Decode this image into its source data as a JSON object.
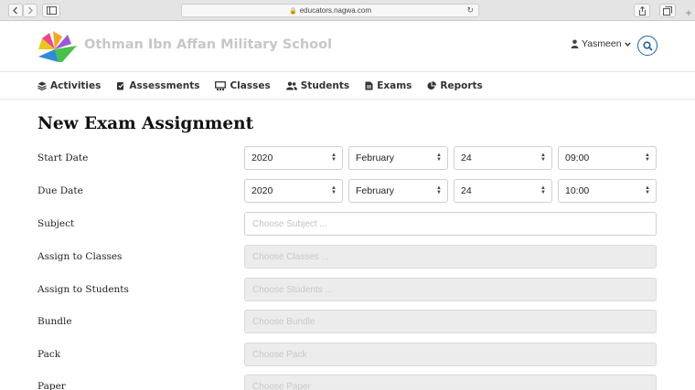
{
  "browser": {
    "url": "educators.nagwa.com"
  },
  "header": {
    "school_name": "Othman Ibn Affan Military School",
    "user_name": "Yasmeen"
  },
  "nav": {
    "items": [
      {
        "label": "Activities",
        "icon": "layers-icon"
      },
      {
        "label": "Assessments",
        "icon": "assessment-icon"
      },
      {
        "label": "Classes",
        "icon": "classroom-icon"
      },
      {
        "label": "Students",
        "icon": "users-icon"
      },
      {
        "label": "Exams",
        "icon": "document-icon"
      },
      {
        "label": "Reports",
        "icon": "pie-chart-icon"
      }
    ]
  },
  "form": {
    "title": "New Exam Assignment",
    "start_date": {
      "label": "Start Date",
      "year": "2020",
      "month": "February",
      "day": "24",
      "time": "09:00"
    },
    "due_date": {
      "label": "Due Date",
      "year": "2020",
      "month": "February",
      "day": "24",
      "time": "10:00"
    },
    "subject": {
      "label": "Subject",
      "placeholder": "Choose Subject ..."
    },
    "classes": {
      "label": "Assign to Classes",
      "placeholder": "Choose Classes ..."
    },
    "students": {
      "label": "Assign to Students",
      "placeholder": "Choose Students ..."
    },
    "bundle": {
      "label": "Bundle",
      "placeholder": "Choose Bundle"
    },
    "pack": {
      "label": "Pack",
      "placeholder": "Choose Pack"
    },
    "paper": {
      "label": "Paper",
      "placeholder": "Choose Paper"
    }
  },
  "colors": {
    "accent": "#1d5fa8",
    "disabled_field": "#ececec",
    "school_name": "#c7c7c7"
  }
}
